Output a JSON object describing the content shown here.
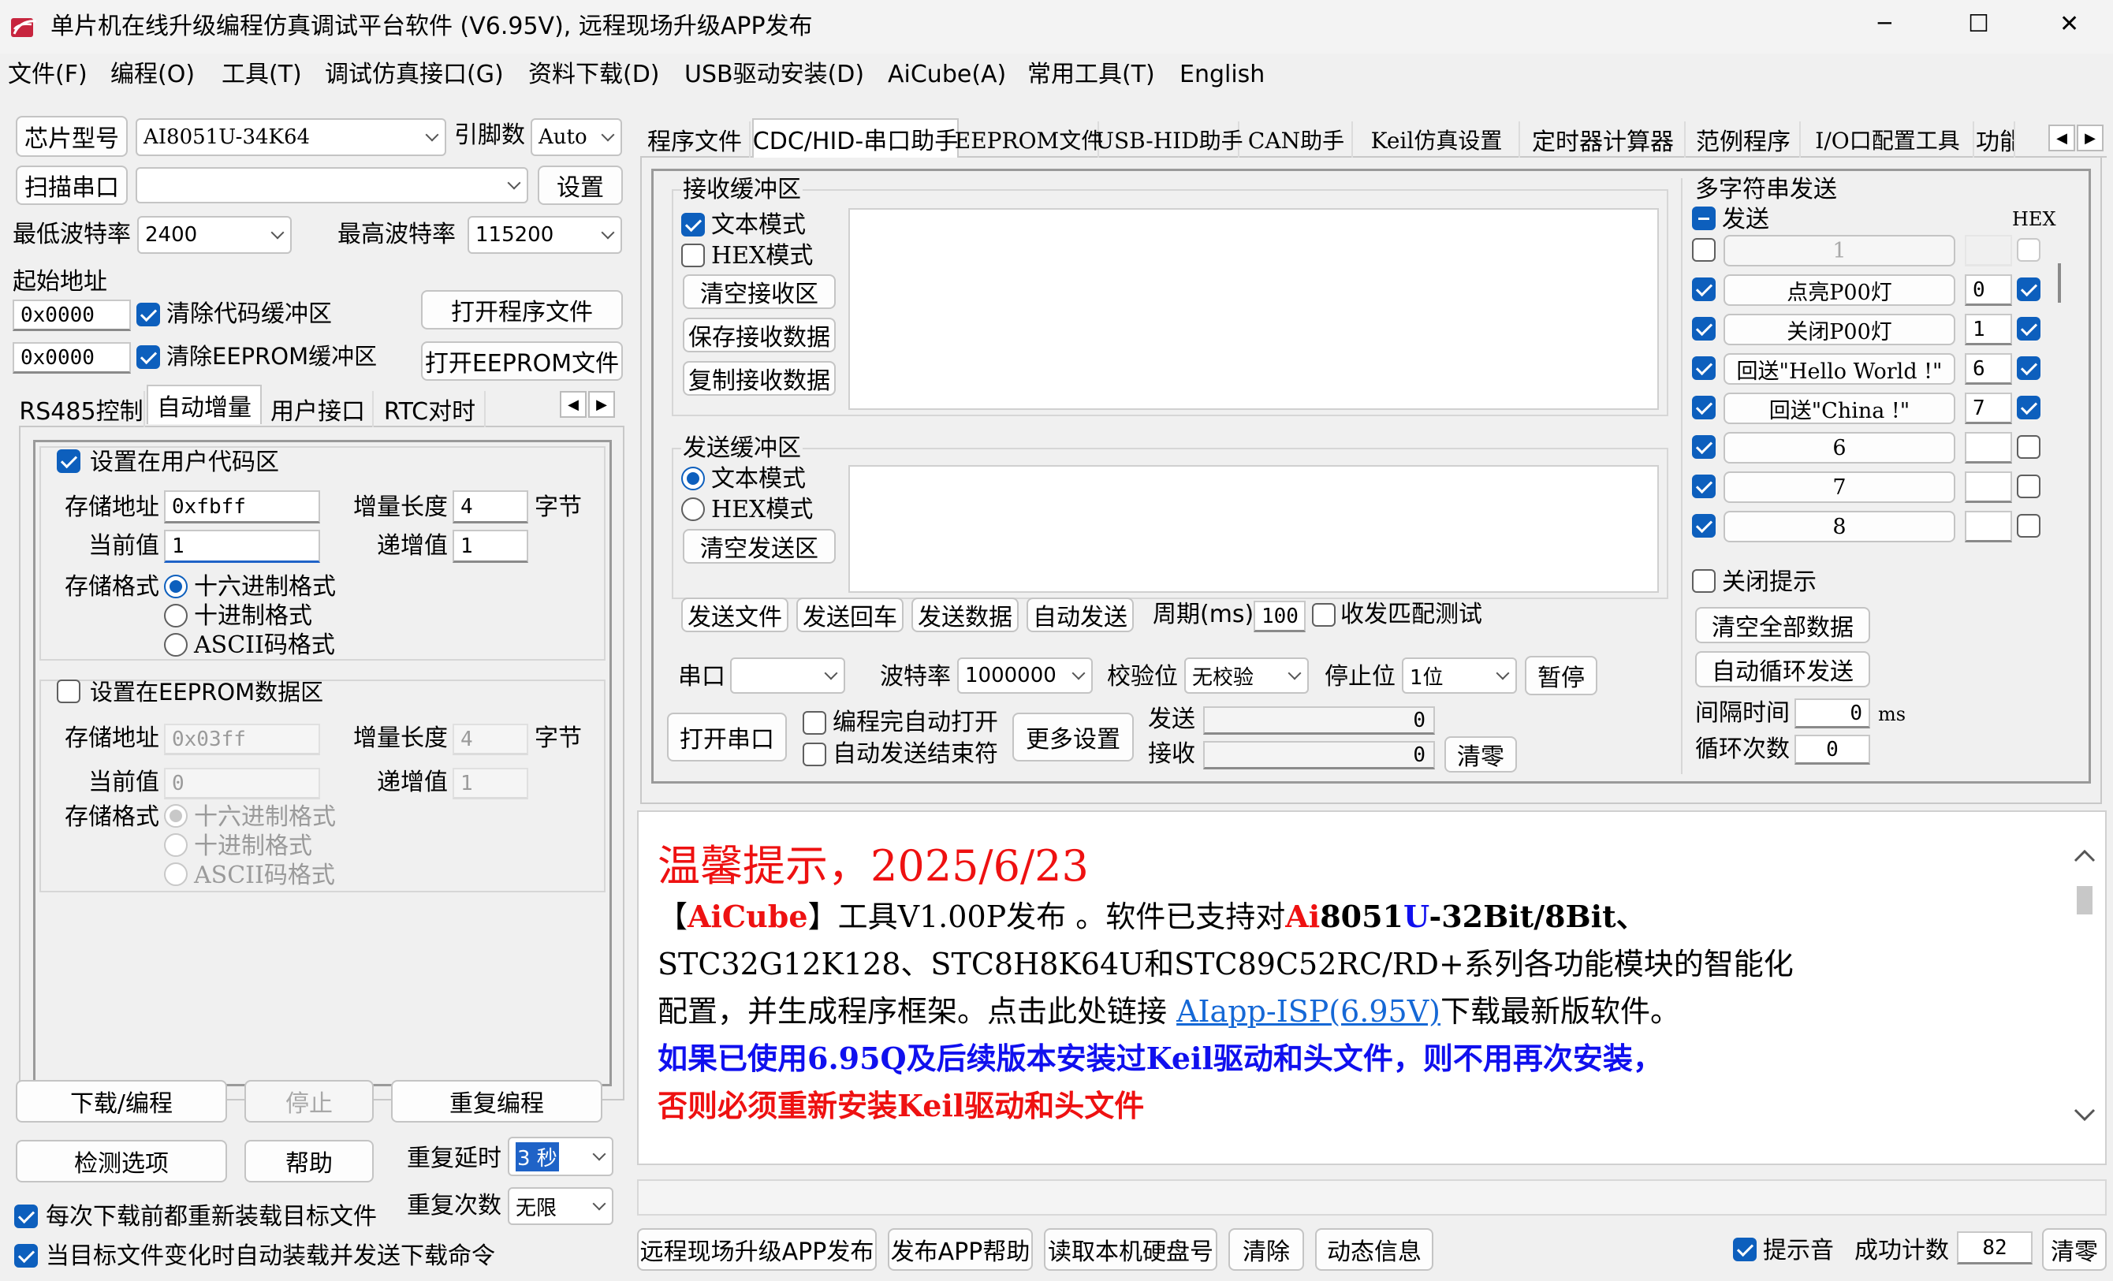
{
  "window": {
    "title": "单片机在线升级编程仿真调试平台软件 (V6.95V), 远程现场升级APP发布",
    "controls": {
      "minimize": "─",
      "maximize": "☐",
      "close": "✕"
    }
  },
  "menu": [
    "文件(F)",
    "编程(O)",
    "工具(T)",
    "调试仿真接口(G)",
    "资料下载(D)",
    "USB驱动安装(D)",
    "AiCube(A)",
    "常用工具(T)",
    "English"
  ],
  "left": {
    "chip_label": "芯片型号",
    "chip_value": "AI8051U-34K64",
    "pins_label": "引脚数",
    "pins_value": "Auto",
    "scan_label": "扫描串口",
    "port_value": "",
    "settings_label": "设置",
    "min_baud_label": "最低波特率",
    "min_baud": "2400",
    "max_baud_label": "最高波特率",
    "max_baud": "115200",
    "start_addr_label": "起始地址",
    "addr1": "0x0000",
    "clear_code": "清除代码缓冲区",
    "open_prog": "打开程序文件",
    "addr2": "0x0000",
    "clear_eeprom": "清除EEPROM缓冲区",
    "open_eeprom": "打开EEPROM文件",
    "tabs": [
      "RS485控制",
      "自动增量",
      "用户接口",
      "RTC对时"
    ],
    "user_code": {
      "title": "设置在用户代码区",
      "addr_label": "存储地址",
      "addr": "0xfbff",
      "len_label": "增量长度",
      "len": "4",
      "unit": "字节",
      "cur_label": "当前值",
      "cur": "1",
      "step_label": "递增值",
      "step": "1",
      "fmt_label": "存储格式",
      "formats": [
        "十六进制格式",
        "十进制格式",
        "ASCII码格式"
      ]
    },
    "eeprom": {
      "title": "设置在EEPROM数据区",
      "addr_label": "存储地址",
      "addr": "0x03ff",
      "len_label": "增量长度",
      "len": "4",
      "unit": "字节",
      "cur_label": "当前值",
      "cur": "0",
      "step_label": "递增值",
      "step": "1",
      "fmt_label": "存储格式",
      "formats": [
        "十六进制格式",
        "十进制格式",
        "ASCII码格式"
      ]
    },
    "download": "下载/编程",
    "stop": "停止",
    "reprogram": "重复编程",
    "check": "检测选项",
    "help": "帮助",
    "delay_label": "重复延时",
    "delay": "3 秒",
    "count_label": "重复次数",
    "count": "无限",
    "reload": "每次下载前都重新装载目标文件",
    "auto_reload": "当目标文件变化时自动装载并发送下载命令"
  },
  "right": {
    "tabs": [
      "程序文件",
      "CDC/HID-串口助手",
      "EEPROM文件",
      "USB-HID助手",
      "CAN助手",
      "Keil仿真设置",
      "定时器计算器",
      "范例程序",
      "I/O口配置工具",
      "功能"
    ],
    "recv": {
      "title": "接收缓冲区",
      "text_mode": "文本模式",
      "hex_mode": "HEX模式",
      "clear": "清空接收区",
      "save": "保存接收数据",
      "copy": "复制接收数据"
    },
    "send": {
      "title": "发送缓冲区",
      "text_mode": "文本模式",
      "hex_mode": "HEX模式",
      "clear": "清空发送区"
    },
    "send_btns": [
      "发送文件",
      "发送回车",
      "发送数据",
      "自动发送"
    ],
    "period_label": "周期(ms)",
    "period": "100",
    "loop_test": "收发匹配测试",
    "port_label": "串口",
    "port": "",
    "baud_label": "波特率",
    "baud": "1000000",
    "parity_label": "校验位",
    "parity": "无校验",
    "stop_label": "停止位",
    "stopbits": "1位",
    "pause": "暂停",
    "open_port": "打开串口",
    "auto_open": "编程完自动打开",
    "auto_end": "自动发送结束符",
    "more": "更多设置",
    "tx_label": "发送",
    "tx": "0",
    "rx_label": "接收",
    "rx": "0",
    "zero": "清零",
    "multi": {
      "title": "多字符串发送",
      "send_label": "发送",
      "hex_label": "HEX",
      "rows": [
        {
          "text": "1",
          "num": "",
          "chk": false,
          "hex": false,
          "dis": true
        },
        {
          "text": "点亮P00灯",
          "num": "0",
          "chk": true,
          "hex": true
        },
        {
          "text": "关闭P00灯",
          "num": "1",
          "chk": true,
          "hex": true
        },
        {
          "text": "回送\"Hello World !\"",
          "num": "6",
          "chk": true,
          "hex": true
        },
        {
          "text": "回送\"China !\"",
          "num": "7",
          "chk": true,
          "hex": true
        },
        {
          "text": "6",
          "num": "",
          "chk": true,
          "hex": false
        },
        {
          "text": "7",
          "num": "",
          "chk": true,
          "hex": false
        },
        {
          "text": "8",
          "num": "",
          "chk": true,
          "hex": false
        }
      ],
      "close_tip": "关闭提示",
      "clear_all": "清空全部数据",
      "auto_loop": "自动循环发送",
      "interval_label": "间隔时间",
      "interval": "0",
      "ms": "ms",
      "loop_label": "循环次数",
      "loops": "0"
    }
  },
  "notice": {
    "title": "温馨提示，2025/6/23",
    "l1a": "【",
    "l1b": "AiCube",
    "l1c": "】工具V1.00P发布 。软件已支持对",
    "l1d": "Ai",
    "l1e": "8051",
    "l1f": "U",
    "l1g": "-32Bit/8Bit、",
    "l2": "STC32G12K128、STC8H8K64U和STC89C52RC/RD+系列各功能模块的智能化",
    "l3a": "配置，并生成程序框架。点击此处链接 ",
    "l3b": "AIapp-ISP(6.95V)",
    "l3c": "下载最新版软件。",
    "l4": "如果已使用6.95Q及后续版本安装过Keil驱动和头文件，则不用再次安装，",
    "l5": "否则必须重新安装Keil驱动和头文件",
    "colors": {
      "red": "#ee1111",
      "blue": "#1010ee",
      "link": "#1568d6"
    }
  },
  "bottom": {
    "buttons": [
      "远程现场升级APP发布",
      "发布APP帮助",
      "读取本机硬盘号",
      "清除",
      "动态信息"
    ],
    "sound": "提示音",
    "success_label": "成功计数",
    "success": "82",
    "zero": "清零"
  }
}
